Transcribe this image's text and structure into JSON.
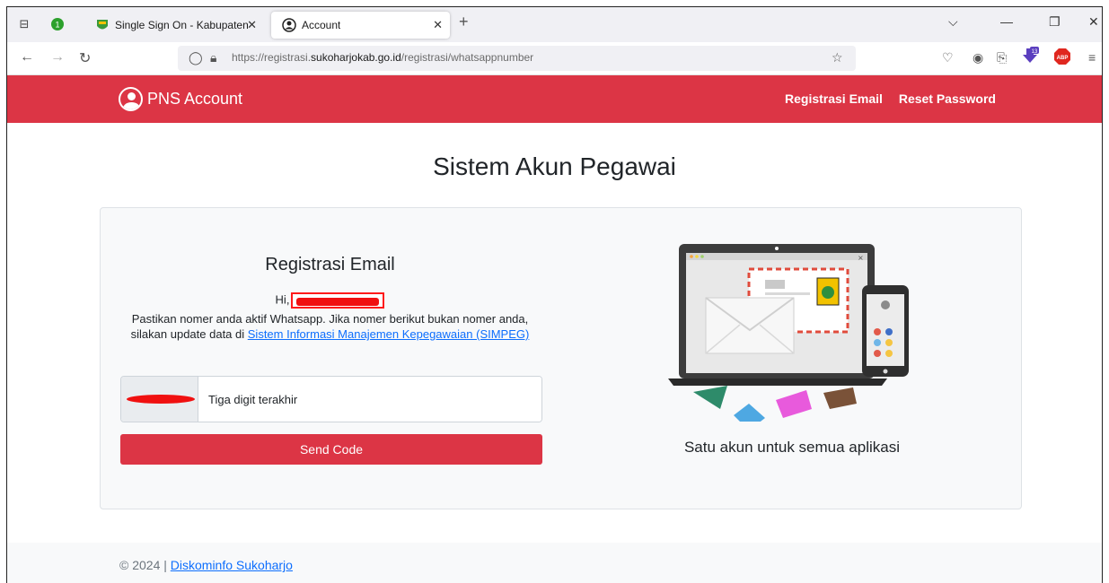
{
  "browser": {
    "tabs": [
      {
        "title": "Single Sign On - Kabupaten Suk",
        "active": false
      },
      {
        "title": "Account",
        "active": true
      }
    ],
    "url_prefix": "https://registrasi.",
    "url_domain": "sukoharjokab.go.id",
    "url_path": "/registrasi/whatsappnumber",
    "badge_count": "13",
    "abp_label": "ABP",
    "tab_counter": "1"
  },
  "header": {
    "brand": "PNS Account",
    "links": [
      "Registrasi Email",
      "Reset Password"
    ]
  },
  "page": {
    "title": "Sistem Akun Pegawai"
  },
  "form": {
    "title": "Registrasi Email",
    "greeting": "Hi,",
    "description": "Pastikan nomer anda aktif Whatsapp. Jika nomer berikut bukan nomer anda, silakan update data di",
    "link_text": "Sistem Informasi Manajemen Kepegawaian (SIMPEG)",
    "input_placeholder": "Tiga digit terakhir",
    "button_label": "Send Code"
  },
  "illustration": {
    "tagline": "Satu akun untuk semua aplikasi"
  },
  "footer": {
    "copyright": "© 2024 |",
    "link_text": "Diskominfo Sukoharjo"
  },
  "colors": {
    "brand_red": "#dc3545",
    "link_blue": "#0d6efd"
  }
}
